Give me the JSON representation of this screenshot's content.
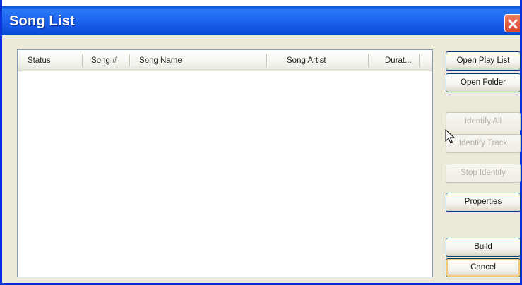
{
  "window": {
    "title": "Song List"
  },
  "list": {
    "columns": [
      "Status",
      "Song #",
      "Song Name",
      "Song Artist",
      "Durat..."
    ],
    "rows": []
  },
  "buttons": {
    "open_play_list": "Open Play List",
    "open_folder": "Open Folder",
    "identify_all": "Identify All",
    "identify_track": "Identify Track",
    "stop_identify": "Stop Identify",
    "properties": "Properties",
    "build": "Build",
    "cancel": "Cancel"
  },
  "colors": {
    "titlebar": "#0b4fd9",
    "close_button": "#d8452c",
    "dialog_background": "#ece9d8"
  },
  "icons": {
    "close": "close-icon",
    "cursor": "mouse-pointer-icon"
  }
}
